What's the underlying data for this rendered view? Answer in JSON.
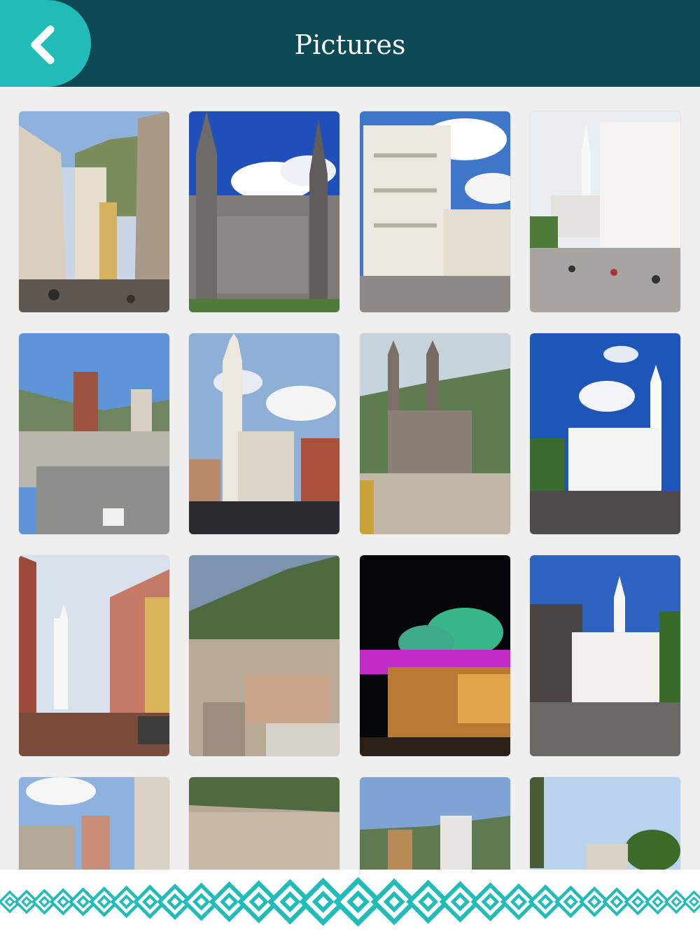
{
  "header": {
    "title": "Pictures",
    "back_icon": "chevron-left-icon"
  },
  "colors": {
    "header_bg": "#0e4a56",
    "accent": "#22bcb8",
    "page_bg": "#efefef"
  },
  "gallery": {
    "photos": [
      {
        "name": "photo-colonial-street"
      },
      {
        "name": "photo-gothic-basilica"
      },
      {
        "name": "photo-white-palace"
      },
      {
        "name": "photo-plaza-bell-tower"
      },
      {
        "name": "photo-city-rooftops"
      },
      {
        "name": "photo-church-crowd"
      },
      {
        "name": "photo-basilica-hillside"
      },
      {
        "name": "photo-white-cathedral"
      },
      {
        "name": "photo-street-white-tower"
      },
      {
        "name": "photo-hillside-city"
      },
      {
        "name": "photo-night-domes"
      },
      {
        "name": "photo-cathedral-steps"
      },
      {
        "name": "photo-modern-buildings"
      },
      {
        "name": "photo-city-panorama"
      },
      {
        "name": "photo-skyline-towers"
      },
      {
        "name": "photo-palm-monument"
      }
    ]
  }
}
